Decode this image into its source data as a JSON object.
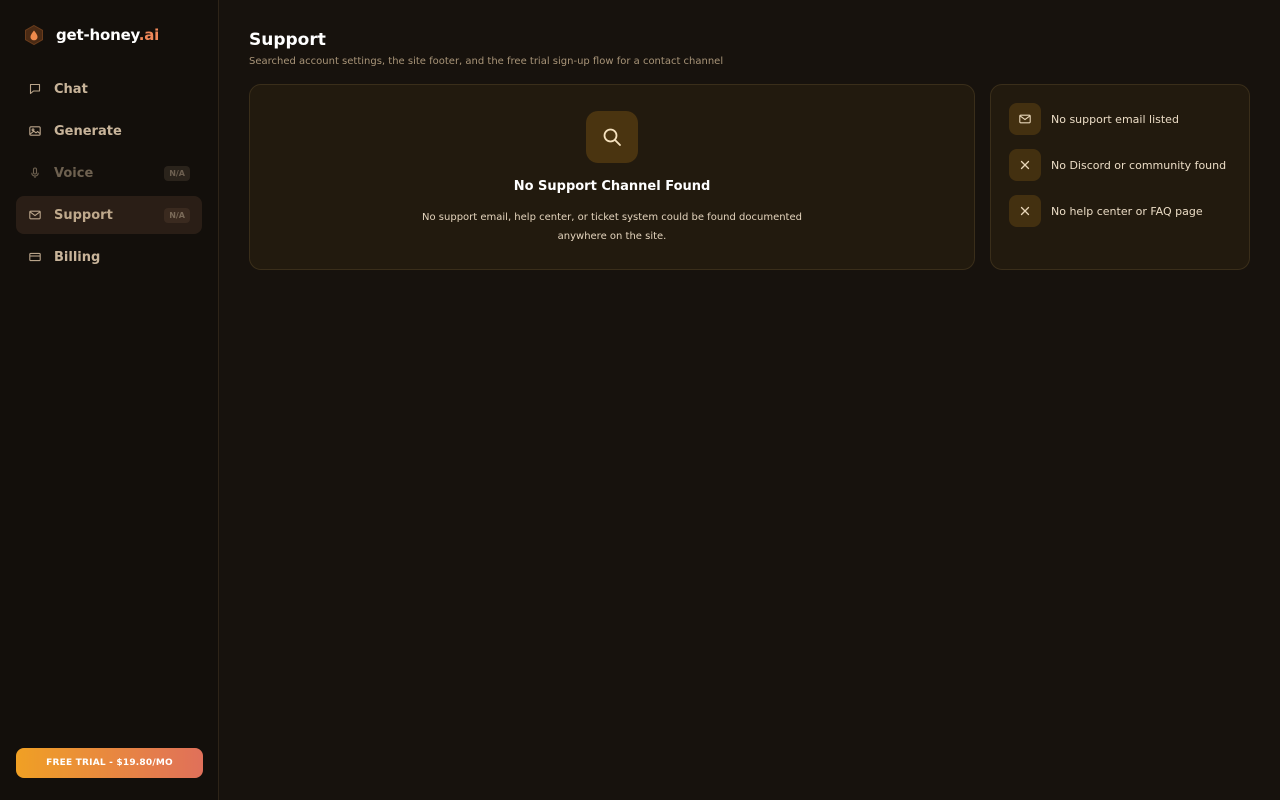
{
  "brand": {
    "name": "get-honey",
    "tld": ".ai"
  },
  "sidebar": {
    "items": [
      {
        "label": "Chat",
        "icon": "chat-icon"
      },
      {
        "label": "Generate",
        "icon": "image-icon"
      },
      {
        "label": "Voice",
        "icon": "mic-icon",
        "badge": "N/A"
      },
      {
        "label": "Support",
        "icon": "mail-icon",
        "badge": "N/A"
      },
      {
        "label": "Billing",
        "icon": "card-icon"
      }
    ],
    "trial_button": "FREE TRIAL - $19.80/MO"
  },
  "main": {
    "title": "Support",
    "subtitle": "Searched account settings, the site footer, and the free trial sign-up flow for a contact channel",
    "empty_state": {
      "icon": "search-icon",
      "title": "No Support Channel Found",
      "description": "No support email, help center, or ticket system could be found documented anywhere on the site."
    },
    "checks": [
      {
        "icon": "mail-icon",
        "text": "No support email listed"
      },
      {
        "icon": "x-icon",
        "text": "No Discord or community found"
      },
      {
        "icon": "x-icon",
        "text": "No help center or FAQ page"
      }
    ]
  },
  "colors": {
    "background": "#17120d",
    "sidebar": "#130f0b",
    "accent_orange": "#f0885a",
    "card": "#221a0e",
    "trial_gradient_start": "#f0a024",
    "trial_gradient_end": "#e0705a"
  }
}
